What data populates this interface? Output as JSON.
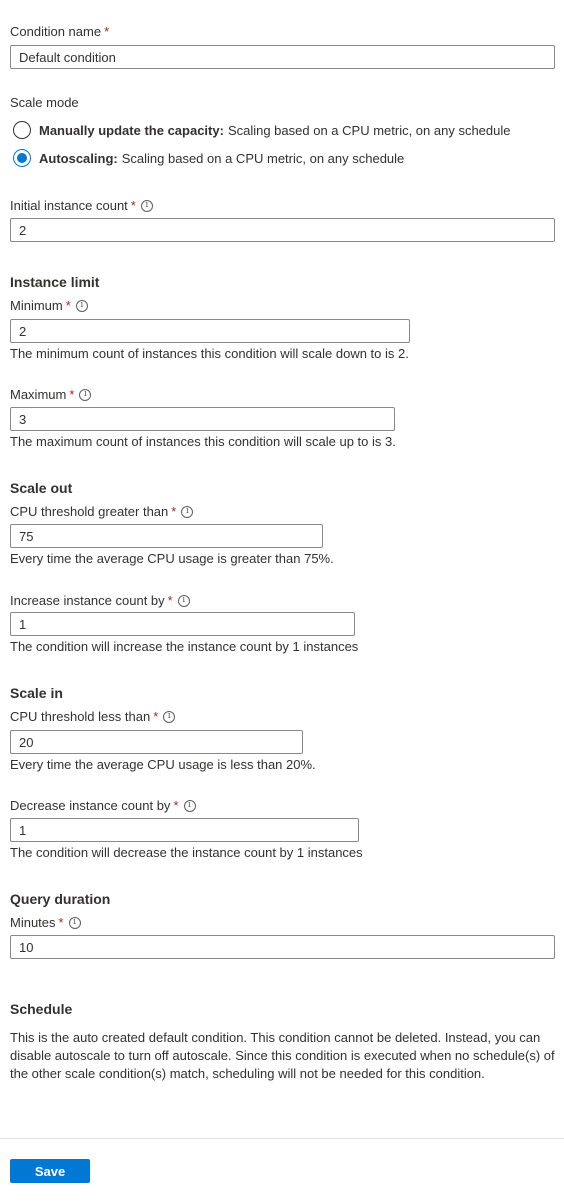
{
  "condition_name": {
    "label": "Condition name",
    "required": "*",
    "value": "Default condition"
  },
  "scale_mode": {
    "label": "Scale mode",
    "options": [
      {
        "title": "Manually update the capacity:",
        "description": "Scaling based on a CPU metric, on any schedule",
        "selected": false
      },
      {
        "title": "Autoscaling:",
        "description": "Scaling based on a CPU metric, on any schedule",
        "selected": true
      }
    ]
  },
  "initial_instance_count": {
    "label": "Initial instance count",
    "required": "*",
    "info_icon": "i",
    "value": "2"
  },
  "instance_limit": {
    "heading": "Instance limit",
    "minimum": {
      "label": "Minimum",
      "required": "*",
      "info_icon": "i",
      "value": "2",
      "help": "The minimum count of instances this condition will scale down to is 2."
    },
    "maximum": {
      "label": "Maximum",
      "required": "*",
      "info_icon": "i",
      "value": "3",
      "help": "The maximum count of instances this condition will scale up to is 3."
    }
  },
  "scale_out": {
    "heading": "Scale out",
    "cpu_threshold": {
      "label": "CPU threshold greater than",
      "required": "*",
      "info_icon": "i",
      "value": "75",
      "help": "Every time the average CPU usage is greater than 75%."
    },
    "increase_count": {
      "label": "Increase instance count by",
      "required": "*",
      "info_icon": "i",
      "value": "1",
      "help": "The condition will increase the instance count by 1 instances"
    }
  },
  "scale_in": {
    "heading": "Scale in",
    "cpu_threshold": {
      "label": "CPU threshold less than",
      "required": "*",
      "info_icon": "i",
      "value": "20",
      "help": "Every time the average CPU usage is less than 20%."
    },
    "decrease_count": {
      "label": "Decrease instance count by",
      "required": "*",
      "info_icon": "i",
      "value": "1",
      "help": "The condition will decrease the instance count by 1 instances"
    }
  },
  "query_duration": {
    "heading": "Query duration",
    "minutes": {
      "label": "Minutes",
      "required": "*",
      "info_icon": "i",
      "value": "10"
    }
  },
  "schedule": {
    "heading": "Schedule",
    "text": "This is the auto created default condition. This condition cannot be deleted. Instead, you can disable autoscale to turn off autoscale. Since this condition is executed when no schedule(s) of the other scale condition(s) match, scheduling will not be needed for this condition."
  },
  "footer": {
    "save_label": "Save"
  },
  "colors": {
    "accent": "#0078d4",
    "required": "#a4262c",
    "border": "#8a8886",
    "text": "#323130"
  }
}
